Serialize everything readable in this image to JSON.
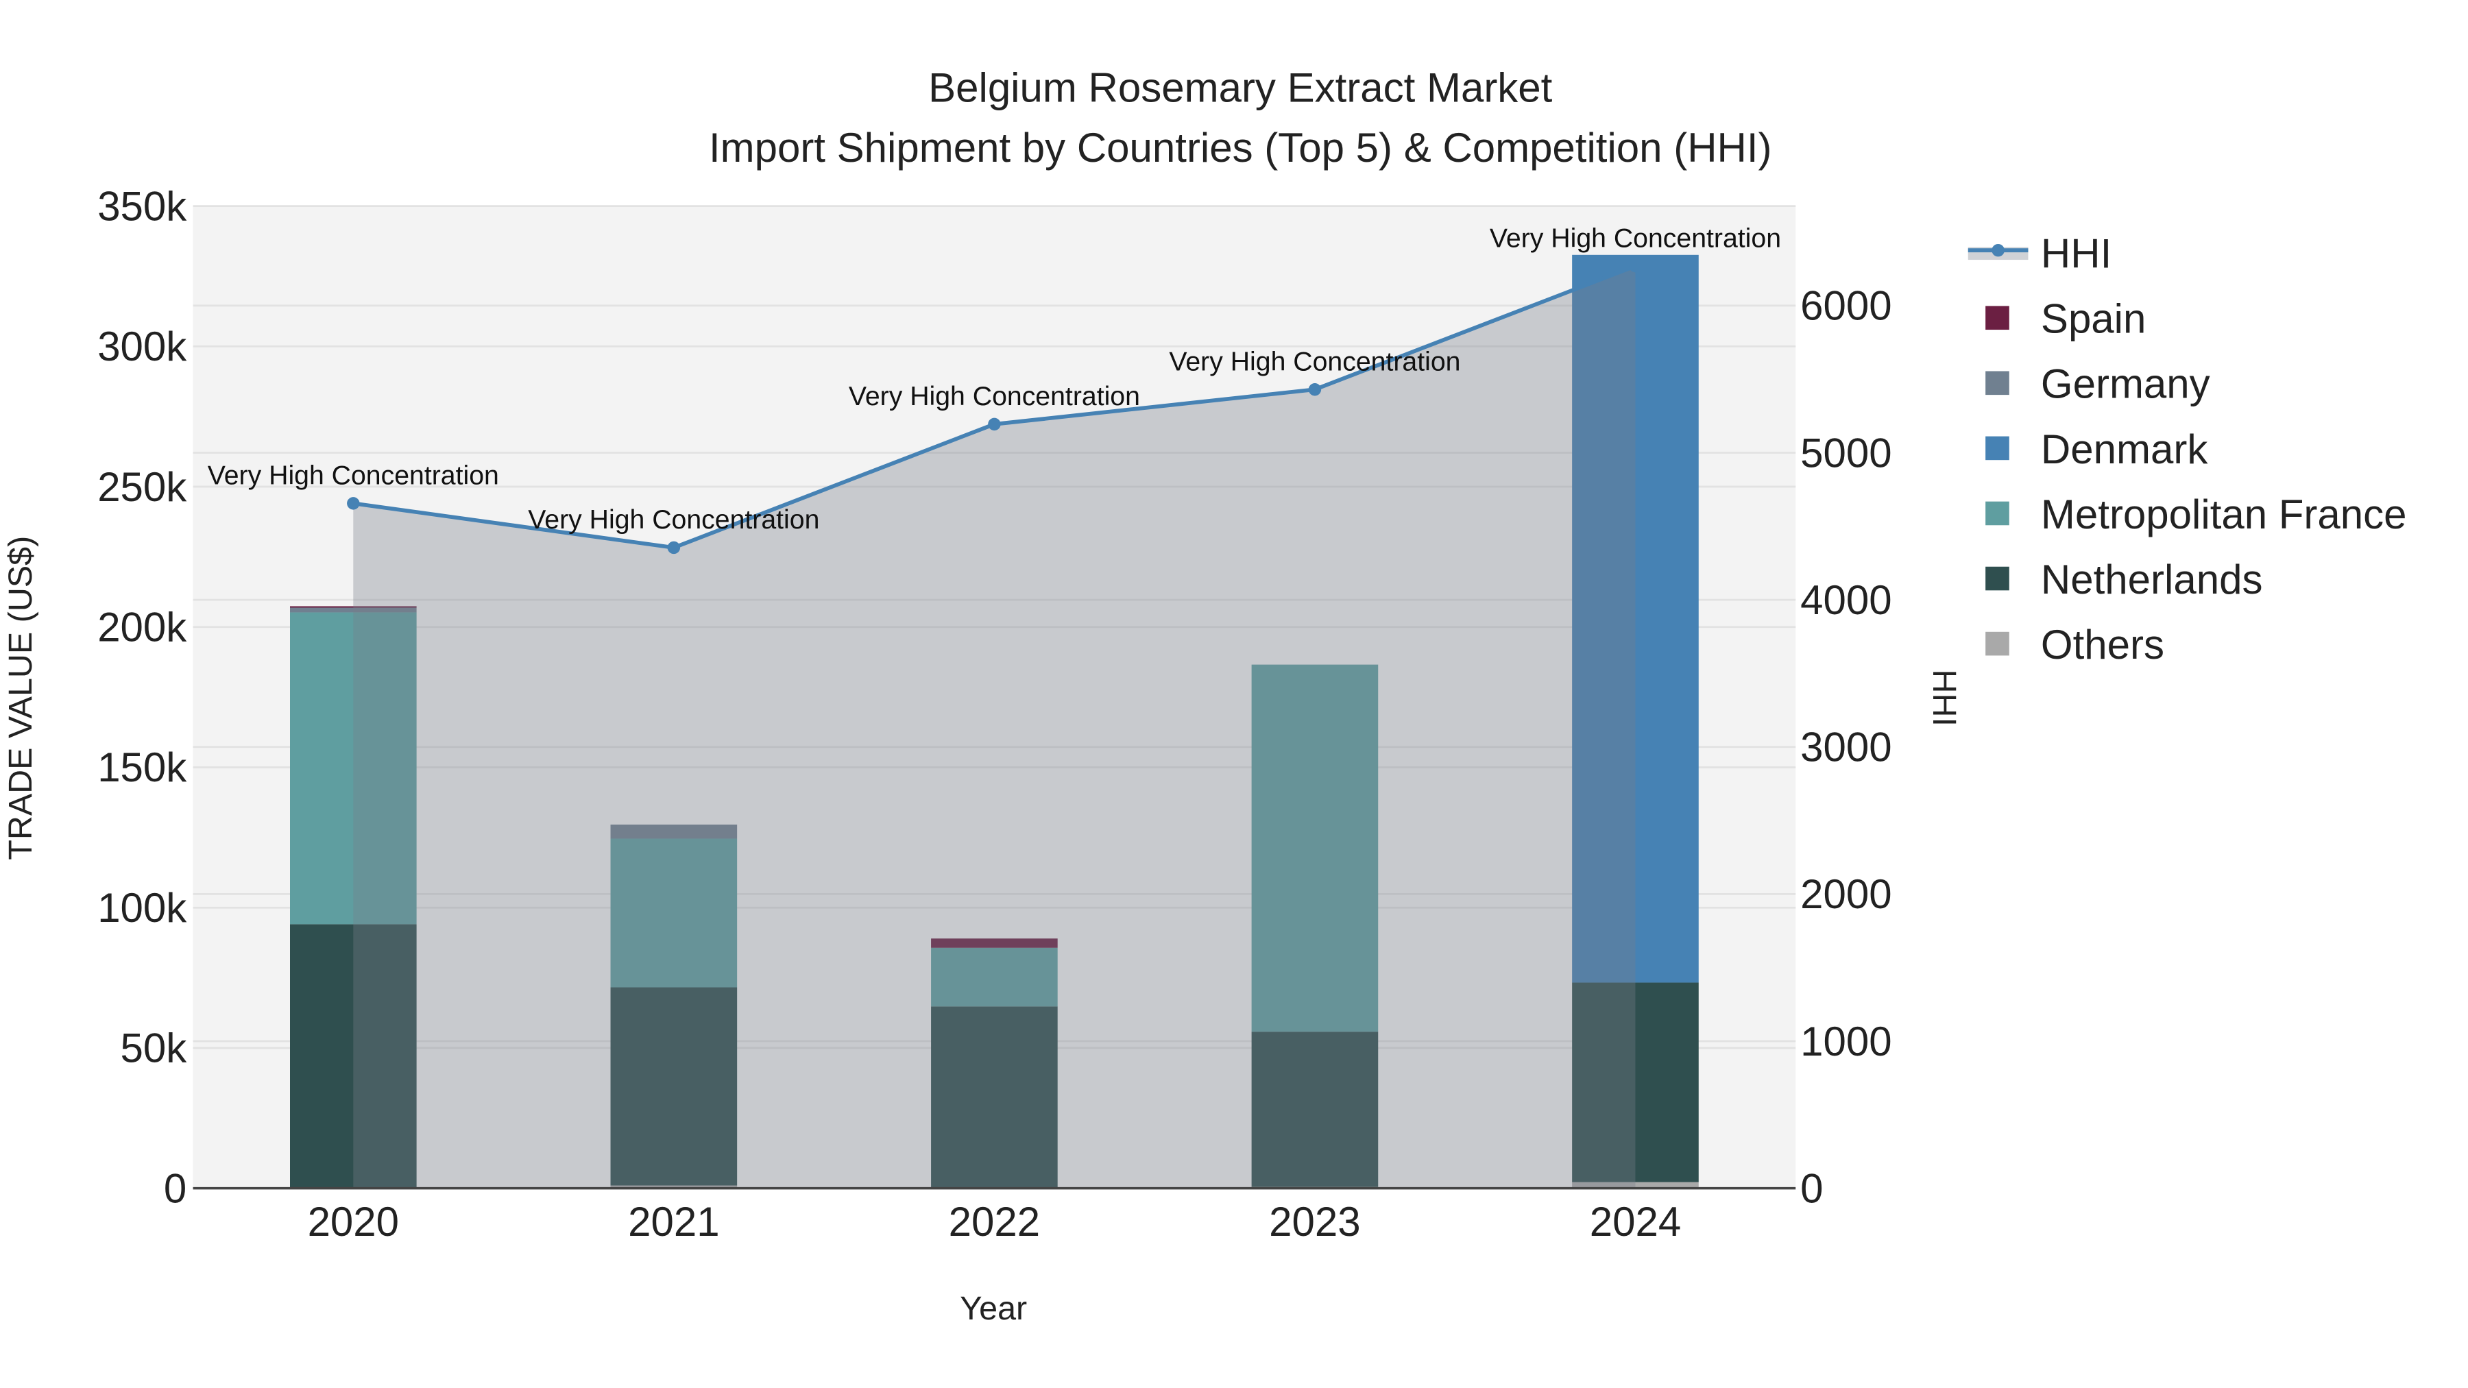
{
  "chart_data": {
    "type": "bar",
    "title": "Belgium Rosemary Extract Market",
    "subtitle": "Import Shipment by Countries (Top 5) & Competition (HHI)",
    "xlabel": "Year",
    "ylabel": "TRADE VALUE (US$)",
    "y2label": "HHI",
    "categories": [
      "2020",
      "2021",
      "2022",
      "2023",
      "2024"
    ],
    "ylim": [
      0,
      350000
    ],
    "y_ticks": [
      0,
      50000,
      100000,
      150000,
      200000,
      250000,
      300000,
      350000
    ],
    "y_tick_labels": [
      "0",
      "50k",
      "100k",
      "150k",
      "200k",
      "250k",
      "300k",
      "350k"
    ],
    "y2lim": [
      0,
      6677
    ],
    "y2_ticks": [
      0,
      1000,
      2000,
      3000,
      4000,
      5000,
      6000
    ],
    "y2_tick_labels": [
      "0",
      "1000",
      "2000",
      "3000",
      "4000",
      "5000",
      "6000"
    ],
    "stacked": true,
    "series": [
      {
        "name": "Others",
        "color": "#a9a9a9",
        "values": [
          0,
          1000,
          300,
          500,
          2200
        ]
      },
      {
        "name": "Netherlands",
        "color": "#2f4f4f",
        "values": [
          94100,
          70600,
          64500,
          55300,
          71100
        ]
      },
      {
        "name": "Metropolitan France",
        "color": "#5f9ea0",
        "values": [
          111100,
          53000,
          20900,
          130800,
          0
        ]
      },
      {
        "name": "Denmark",
        "color": "#4682b4",
        "values": [
          0,
          0,
          0,
          0,
          259300
        ]
      },
      {
        "name": "Germany",
        "color": "#708090",
        "values": [
          1700,
          5000,
          0,
          0,
          0
        ]
      },
      {
        "name": "Spain",
        "color": "#6b1f42",
        "values": [
          500,
          0,
          3300,
          0,
          0
        ]
      }
    ],
    "line": {
      "name": "HHI",
      "color": "#4682b4",
      "axis": "y2",
      "values": [
        4656,
        4355,
        5194,
        5430,
        6269
      ],
      "annotations": [
        "Very High Concentration",
        "Very High Concentration",
        "Very High Concentration",
        "Very High Concentration",
        "Very High Concentration"
      ]
    },
    "legend": {
      "placement": "right",
      "order": [
        "HHI",
        "Spain",
        "Germany",
        "Denmark",
        "Metropolitan France",
        "Netherlands",
        "Others"
      ]
    },
    "grid": true
  }
}
